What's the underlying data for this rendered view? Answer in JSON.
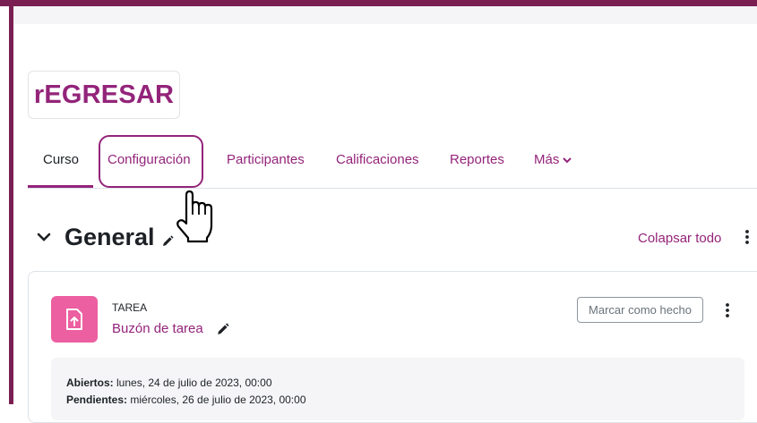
{
  "course": {
    "title": "rEGRESAR"
  },
  "nav": {
    "items": [
      {
        "label": "Curso"
      },
      {
        "label": "Configuración"
      },
      {
        "label": "Participantes"
      },
      {
        "label": "Calificaciones"
      },
      {
        "label": "Reportes"
      },
      {
        "label": "Más"
      }
    ]
  },
  "section": {
    "title": "General",
    "collapse_all": "Colapsar todo"
  },
  "activity": {
    "type": "TAREA",
    "name": "Buzón de tarea",
    "mark_done": "Marcar como hecho",
    "dates": [
      {
        "label": "Abiertos:",
        "value": "lunes, 24 de julio de 2023, 00:00"
      },
      {
        "label": "Pendientes:",
        "value": "miércoles, 26 de julio de 2023, 00:00"
      }
    ]
  },
  "colors": {
    "brand": "#93247a",
    "frame": "#7a1f52",
    "assign_icon_bg": "#ec5fa0"
  },
  "icons": [
    "edit-pencil-icon",
    "chevron-down-icon",
    "kebab-menu-icon",
    "assignment-upload-icon",
    "hand-pointer-cursor"
  ]
}
